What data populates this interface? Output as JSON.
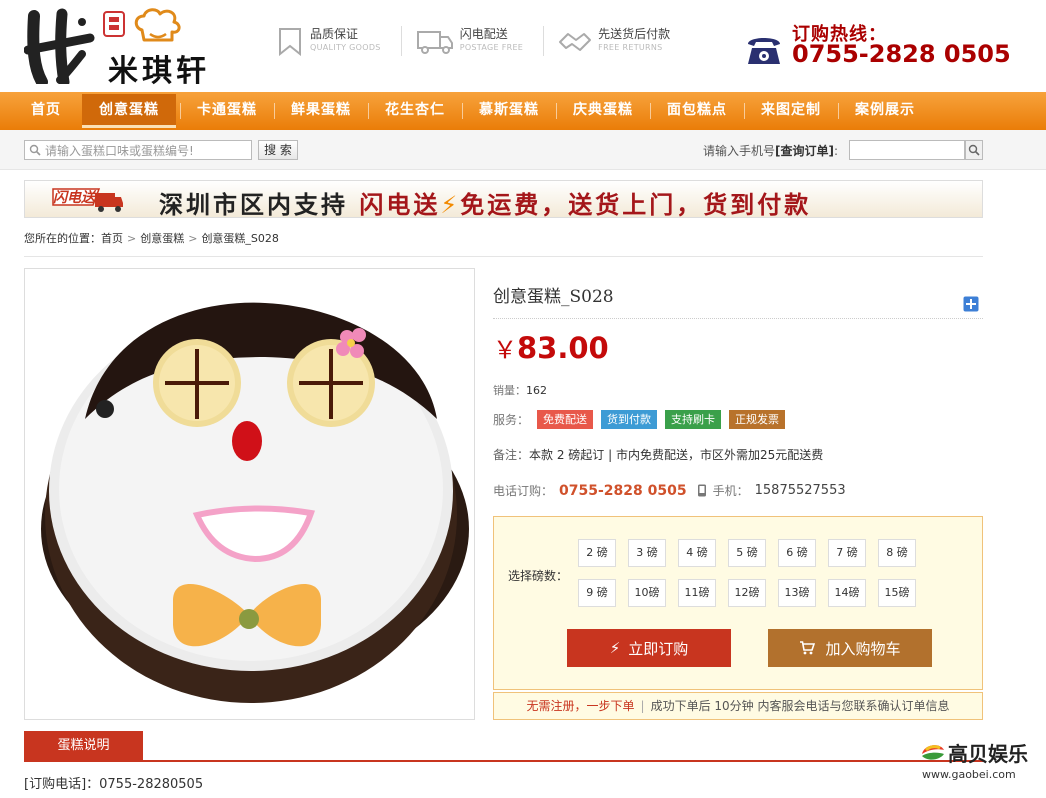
{
  "header": {
    "logo_text": "米琪轩",
    "features": [
      {
        "title": "品质保证",
        "sub": "QUALITY GOODS",
        "icon": "bookmark-icon"
      },
      {
        "title": "闪电配送",
        "sub": "POSTAGE FREE",
        "icon": "truck-icon"
      },
      {
        "title": "先送货后付款",
        "sub": "FREE RETURNS",
        "icon": "handshake-icon"
      }
    ],
    "hotline_label": "订购热线：",
    "hotline_number": "0755-2828 0505"
  },
  "nav": {
    "items": [
      "首页",
      "创意蛋糕",
      "卡通蛋糕",
      "鲜果蛋糕",
      "花生杏仁",
      "慕斯蛋糕",
      "庆典蛋糕",
      "面包糕点",
      "来图定制",
      "案例展示"
    ],
    "active_index": 1
  },
  "search": {
    "placeholder": "请输入蛋糕口味或蛋糕编号!",
    "button": "搜 索",
    "order_label_prefix": "请输入手机号",
    "order_label_link": "[查询订单]",
    "order_label_suffix": ":"
  },
  "banner": {
    "badge": "闪电送",
    "text_a": "深圳市区内支持",
    "text_b": "闪电送",
    "text_c": "免运费，送货上门，货到付款"
  },
  "breadcrumb": {
    "label": "您所在的位置：",
    "items": [
      "首页",
      "创意蛋糕",
      "创意蛋糕_S028"
    ]
  },
  "product": {
    "title": "创意蛋糕_S028",
    "price_symbol": "￥",
    "price": "83.00",
    "sales_label": "销量：",
    "sales_value": "162",
    "service_label": "服务：",
    "service_tags": [
      {
        "label": "免费配送",
        "color": "#e8584a"
      },
      {
        "label": "货到付款",
        "color": "#3d9bd5"
      },
      {
        "label": "支持刷卡",
        "color": "#3aa04a"
      },
      {
        "label": "正规发票",
        "color": "#b8722b"
      }
    ],
    "note_label": "备注：",
    "note_text": "本款 2 磅起订 | 市内免费配送，市区外需加25元配送费",
    "phone_label": "电话订购：",
    "phone_value": "0755-2828 0505",
    "mobile_label": "手机：",
    "mobile_value": "15875527553",
    "weight_label": "选择磅数：",
    "weights": [
      "2 磅",
      "3 磅",
      "4 磅",
      "5 磅",
      "6 磅",
      "7 磅",
      "8 磅",
      "9 磅",
      "10磅",
      "11磅",
      "12磅",
      "13磅",
      "14磅",
      "15磅"
    ],
    "buy_button": "立即订购",
    "cart_button": "加入购物车",
    "notice_em": "无需注册，一步下单",
    "notice_text": "成功下单后 10分钟 内客服会电话与您联系确认订单信息"
  },
  "tabs": {
    "active": "蛋糕说明"
  },
  "description": {
    "phone_line": "[订购电话]：0755-28280505"
  },
  "watermark": {
    "name": "高贝娱乐",
    "url": "www.gaobei.com"
  },
  "colors": {
    "nav_orange": "#ea7d08",
    "accent_red": "#c8351f",
    "price_red": "#c40a0a",
    "cart_brown": "#b2712d"
  }
}
